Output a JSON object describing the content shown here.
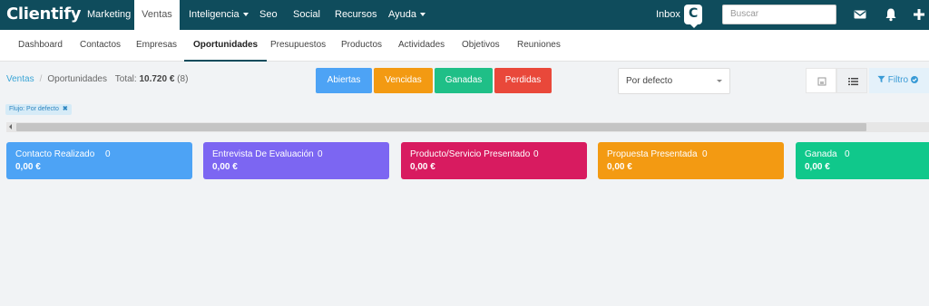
{
  "app": {
    "logo": "Clientify"
  },
  "topnav": [
    {
      "label": "Marketing",
      "dropdown": false,
      "active": false
    },
    {
      "label": "Ventas",
      "dropdown": false,
      "active": true
    },
    {
      "label": "Inteligencia",
      "dropdown": true,
      "active": false
    },
    {
      "label": "Seo",
      "dropdown": false,
      "active": false
    },
    {
      "label": "Social",
      "dropdown": false,
      "active": false
    },
    {
      "label": "Recursos",
      "dropdown": false,
      "active": false
    },
    {
      "label": "Ayuda",
      "dropdown": true,
      "active": false
    }
  ],
  "header_right": {
    "inbox_label": "Inbox",
    "inbox_badge": "C",
    "search_placeholder": "Buscar",
    "icons": [
      "envelope-icon",
      "bell-icon",
      "plus-icon"
    ]
  },
  "subnav": [
    {
      "label": "Dashboard",
      "active": false
    },
    {
      "label": "Contactos",
      "active": false
    },
    {
      "label": "Empresas",
      "active": false
    },
    {
      "label": "Oportunidades",
      "active": true
    },
    {
      "label": "Presupuestos",
      "active": false
    },
    {
      "label": "Productos",
      "active": false
    },
    {
      "label": "Actividades",
      "active": false
    },
    {
      "label": "Objetivos",
      "active": false
    },
    {
      "label": "Reuniones",
      "active": false
    }
  ],
  "breadcrumb": {
    "root": "Ventas",
    "current": "Oportunidades",
    "total_label": "Total:",
    "total_value": "10.720 €",
    "total_count": "(8)"
  },
  "status_filters": [
    {
      "label": "Abiertas",
      "color": "#4da3f5"
    },
    {
      "label": "Vencidas",
      "color": "#f39a12"
    },
    {
      "label": "Ganadas",
      "color": "#1fbf87"
    },
    {
      "label": "Perdidas",
      "color": "#e9483a"
    }
  ],
  "sort_select": {
    "value": "Por defecto"
  },
  "view_toggle": [
    "grid-view-icon",
    "list-view-icon"
  ],
  "filter_button": {
    "label": "Filtro"
  },
  "flow_tag": {
    "label": "Flujo: Por defecto"
  },
  "stages": [
    {
      "name": "Contacto Realizado",
      "count": "0",
      "amount": "0,00 €",
      "color": "#4da3f5"
    },
    {
      "name": "Entrevista De Evaluación",
      "count": "0",
      "amount": "0,00 €",
      "color": "#7c66f2"
    },
    {
      "name": "Producto/Servicio Presentado",
      "count": "0",
      "amount": "0,00 €",
      "color": "#d81b60"
    },
    {
      "name": "Propuesta Presentada",
      "count": "0",
      "amount": "0,00 €",
      "color": "#f39a12"
    },
    {
      "name": "Ganada",
      "count": "0",
      "amount": "0,00 €",
      "color": "#10c88b"
    }
  ]
}
